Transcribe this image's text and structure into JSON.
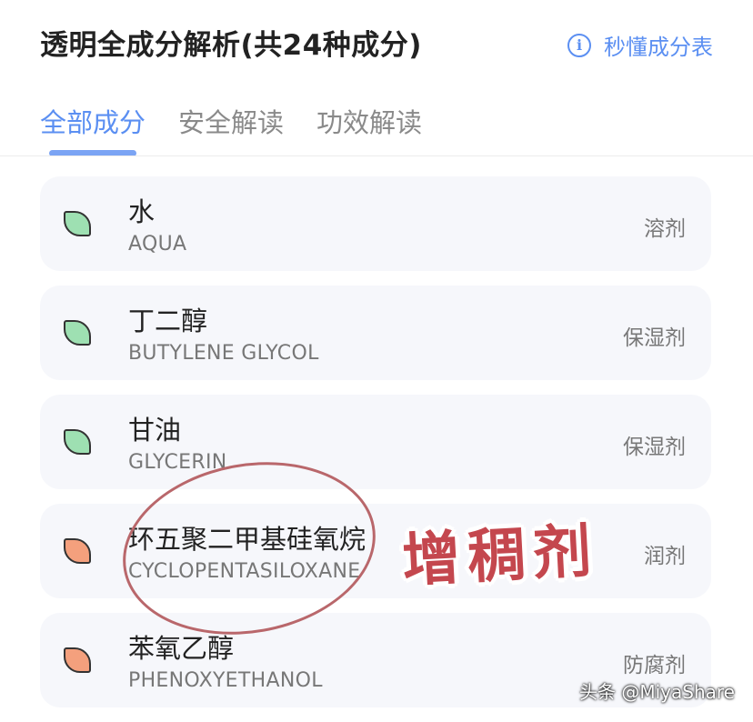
{
  "header": {
    "title": "透明全成分解析(共24种成分)",
    "quick_link_icon": "info-icon",
    "quick_link": "秒懂成分表"
  },
  "tabs": [
    {
      "label": "全部成分",
      "active": true
    },
    {
      "label": "安全解读",
      "active": false
    },
    {
      "label": "功效解读",
      "active": false
    }
  ],
  "ingredients": [
    {
      "cn": "水",
      "en": "AQUA",
      "function": "溶剂",
      "rating": "safe"
    },
    {
      "cn": "丁二醇",
      "en": "BUTYLENE GLYCOL",
      "function": "保湿剂",
      "rating": "safe"
    },
    {
      "cn": "甘油",
      "en": "GLYCERIN",
      "function": "保湿剂",
      "rating": "safe"
    },
    {
      "cn": "环五聚二甲基硅氧烷",
      "en": "CYCLOPENTASILOXANE",
      "function": "润剂",
      "rating": "warn"
    },
    {
      "cn": "苯氧乙醇",
      "en": "PHENOXYETHANOL",
      "function": "防腐剂",
      "rating": "warn"
    }
  ],
  "colors": {
    "accent": "#5b8ff2",
    "safe_leaf": "#9ee0b2",
    "warn_leaf": "#f4a07d",
    "annotation": "#c4474e"
  },
  "annotation": {
    "handwritten_note": "增稠剂"
  },
  "watermark": "头条 @MiyaShare"
}
